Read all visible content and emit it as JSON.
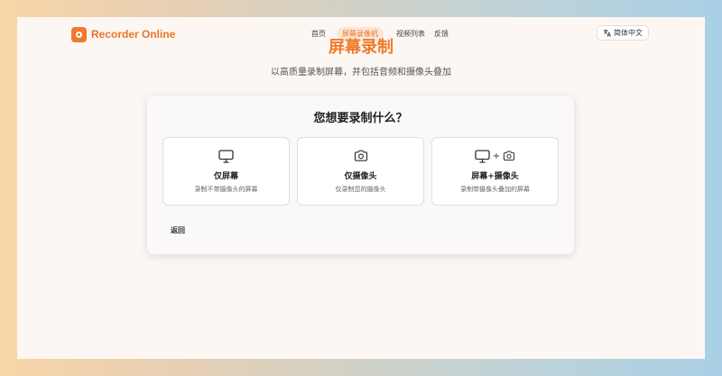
{
  "header": {
    "logo_text": "Recorder Online",
    "nav": {
      "home": "首页",
      "screen_recorder": "屏幕录像机",
      "video_list": "视频列表",
      "feedback": "反馈"
    },
    "language": "简体中文"
  },
  "hero": {
    "title": "屏幕录制",
    "subtitle": "以高质量录制屏幕，并包括音频和摄像头叠加"
  },
  "card": {
    "title": "您想要录制什么？",
    "options": [
      {
        "title": "仅屏幕",
        "desc": "录制不带摄像头的屏幕",
        "icon": "monitor-icon"
      },
      {
        "title": "仅摄像头",
        "desc": "仅录制您的摄像头",
        "icon": "camera-icon"
      },
      {
        "title": "屏幕+摄像头",
        "plus": "+",
        "desc": "录制带摄像头叠加的屏幕",
        "icon": "monitor-camera-icon"
      }
    ],
    "back_label": "返回"
  },
  "colors": {
    "accent": "#f07a2c",
    "nav_active_bg": "#fbe6d6",
    "page_bg": "#fdf7f3"
  }
}
